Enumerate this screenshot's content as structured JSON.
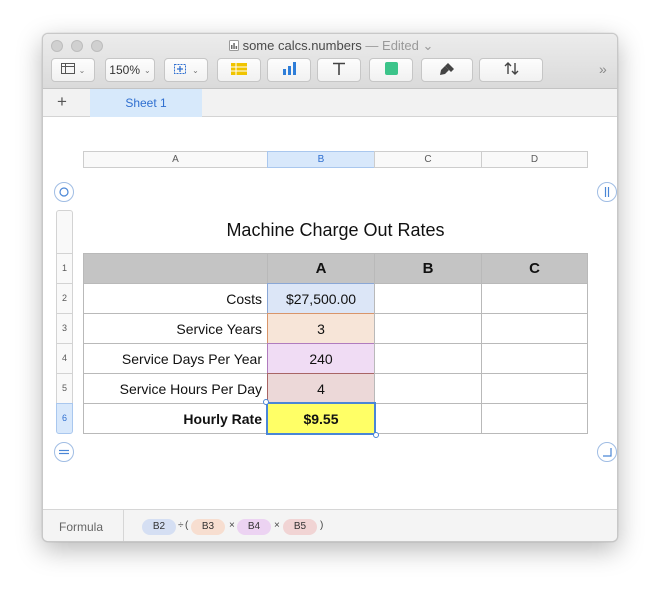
{
  "window": {
    "title": "some calcs.numbers",
    "title_status": "— Edited",
    "title_chevron": "⌄"
  },
  "toolbar": {
    "view_icon": "sidebar-view-icon",
    "zoom_value": "150%",
    "chevron": "⌄",
    "overflow": "»",
    "buttons": [
      "view",
      "zoom",
      "insert",
      "table",
      "chart",
      "text",
      "shape",
      "format",
      "sort"
    ]
  },
  "tabs": {
    "add_label": "+",
    "sheets": [
      {
        "label": "Sheet 1",
        "selected": true
      }
    ]
  },
  "column_headers": [
    {
      "label": "A"
    },
    {
      "label": "B"
    },
    {
      "label": "C"
    },
    {
      "label": "D"
    }
  ],
  "row_headers": [
    "1",
    "2",
    "3",
    "4",
    "5",
    "6"
  ],
  "table": {
    "title": "Machine Charge Out Rates",
    "header": [
      "",
      "A",
      "B",
      "C"
    ],
    "rows": [
      {
        "label": "Costs",
        "value": "$27,500.00",
        "color": "#dce6f7",
        "border": "#8aa7d6"
      },
      {
        "label": "Service Years",
        "value": "3",
        "color": "#f7e5d8",
        "border": "#d9956a"
      },
      {
        "label": "Service Days Per Year",
        "value": "240",
        "color": "#f0dcf4",
        "border": "#b07bbe"
      },
      {
        "label": "Service Hours Per Day",
        "value": "4",
        "color": "#ecd8d8",
        "border": "#a86565"
      },
      {
        "label": "Hourly Rate",
        "value": "$9.55",
        "color": "#ffff66",
        "border": "#4a86d6"
      }
    ]
  },
  "formula": {
    "label": "Formula",
    "tokens": [
      "B2",
      "÷",
      "(",
      "B3",
      "×",
      "B4",
      "×",
      "B5",
      ")"
    ]
  },
  "colors": {
    "accent": "#2f6fd0",
    "selection": "#d8e8fb",
    "header_gray": "#c4c4c4",
    "result_yellow": "#ffff66"
  }
}
